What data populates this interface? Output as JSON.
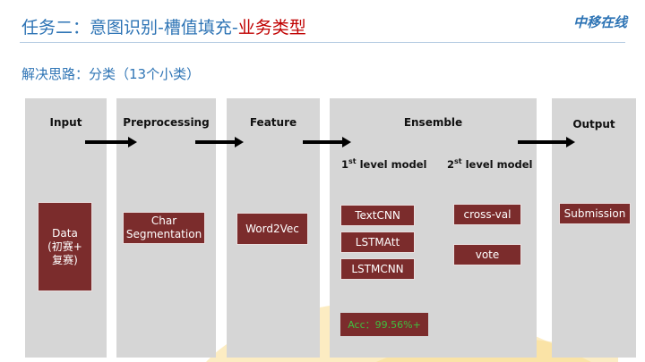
{
  "header": {
    "title_main": "任务二：意图识别-槽值填充-",
    "title_highlight": "业务类型",
    "logo_text": "中移在线",
    "subtitle": "解决思路：分类（13个小类）"
  },
  "stages": {
    "input": "Input",
    "preprocessing": "Preprocessing",
    "feature": "Feature",
    "ensemble": "Ensemble",
    "output": "Output"
  },
  "ensemble": {
    "level1_num": "1",
    "level1_sup": "st",
    "level1_text": " level model",
    "level2_num": "2",
    "level2_sup": "st",
    "level2_text": " level model",
    "models_l1": [
      "TextCNN",
      "LSTMAtt",
      "LSTMCNN"
    ],
    "models_l2": [
      "cross-val",
      "vote"
    ],
    "accuracy": "Acc：99.56%+"
  },
  "boxes": {
    "data_line1": "Data",
    "data_line2": "(初赛+",
    "data_line3": "复赛)",
    "char_line1": "Char",
    "char_line2": "Segmentation",
    "word2vec": "Word2Vec",
    "submission": "Submission"
  },
  "colors": {
    "title_blue": "#2e74b5",
    "title_red": "#c00000",
    "panel_gray": "#d6d6d6",
    "box_maroon": "#7b2c2c",
    "accuracy_green": "#3fbf3f"
  }
}
